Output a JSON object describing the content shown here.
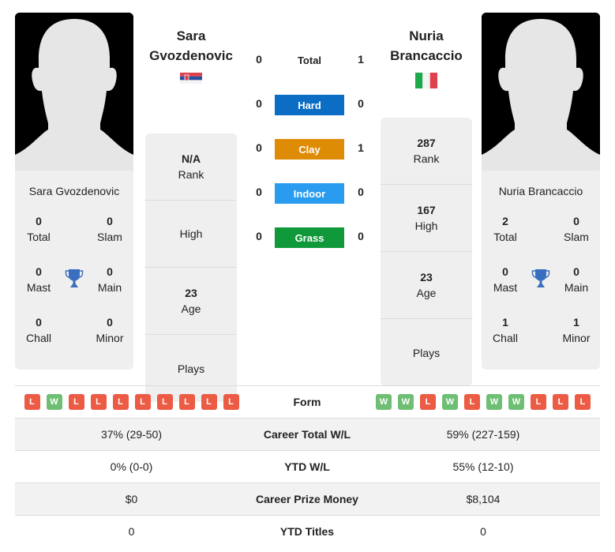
{
  "colors": {
    "hard": "#0b6dc4",
    "clay": "#de8b06",
    "indoor": "#2a9cf0",
    "grass": "#10993a",
    "win": "#6ebf74",
    "loss": "#ec5b44",
    "trophy": "#3a6fc0"
  },
  "player1": {
    "name_line1": "Sara",
    "name_line2": "Gvozdenovic",
    "full_name": "Sara Gvozdenovic",
    "flag": "serbia-flag",
    "titles": {
      "total": "0",
      "total_label": "Total",
      "slam": "0",
      "slam_label": "Slam",
      "mast": "0",
      "mast_label": "Mast",
      "main": "0",
      "main_label": "Main",
      "chall": "0",
      "chall_label": "Chall",
      "minor": "0",
      "minor_label": "Minor"
    },
    "stats": {
      "rank": "N/A",
      "rank_label": "Rank",
      "high": "",
      "high_label": "High",
      "age": "23",
      "age_label": "Age",
      "plays": "",
      "plays_label": "Plays"
    },
    "form": [
      "L",
      "W",
      "L",
      "L",
      "L",
      "L",
      "L",
      "L",
      "L",
      "L"
    ],
    "career_wl": "37% (29-50)",
    "ytd_wl": "0% (0-0)",
    "prize_money": "$0",
    "ytd_titles": "0"
  },
  "player2": {
    "name_line1": "Nuria",
    "name_line2": "Brancaccio",
    "full_name": "Nuria Brancaccio",
    "flag": "italy-flag",
    "titles": {
      "total": "2",
      "total_label": "Total",
      "slam": "0",
      "slam_label": "Slam",
      "mast": "0",
      "mast_label": "Mast",
      "main": "0",
      "main_label": "Main",
      "chall": "1",
      "chall_label": "Chall",
      "minor": "1",
      "minor_label": "Minor"
    },
    "stats": {
      "rank": "287",
      "rank_label": "Rank",
      "high": "167",
      "high_label": "High",
      "age": "23",
      "age_label": "Age",
      "plays": "",
      "plays_label": "Plays"
    },
    "form": [
      "W",
      "W",
      "L",
      "W",
      "L",
      "W",
      "W",
      "L",
      "L",
      "L"
    ],
    "career_wl": "59% (227-159)",
    "ytd_wl": "55% (12-10)",
    "prize_money": "$8,104",
    "ytd_titles": "0"
  },
  "h2h": {
    "total": {
      "label": "Total",
      "p1": "0",
      "p2": "1"
    },
    "surfaces": [
      {
        "key": "hard",
        "label": "Hard",
        "p1": "0",
        "p2": "0"
      },
      {
        "key": "clay",
        "label": "Clay",
        "p1": "0",
        "p2": "1"
      },
      {
        "key": "indoor",
        "label": "Indoor",
        "p1": "0",
        "p2": "0"
      },
      {
        "key": "grass",
        "label": "Grass",
        "p1": "0",
        "p2": "0"
      }
    ]
  },
  "table_labels": {
    "form": "Form",
    "career_wl": "Career Total W/L",
    "ytd_wl": "YTD W/L",
    "prize_money": "Career Prize Money",
    "ytd_titles": "YTD Titles"
  }
}
